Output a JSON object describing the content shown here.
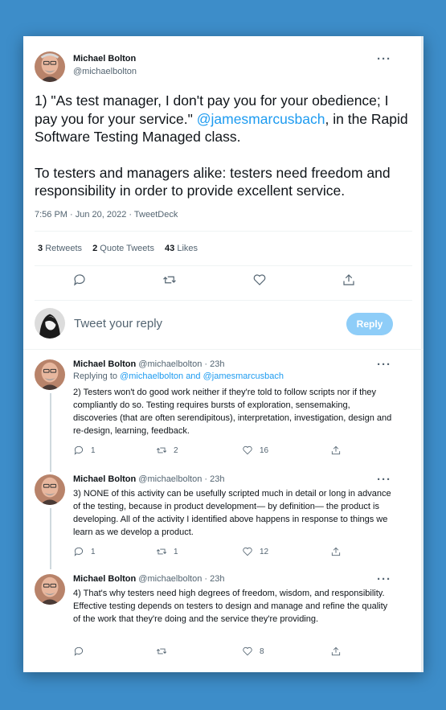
{
  "tweet": {
    "author_name": "Michael Bolton",
    "author_handle": "@michaelbolton",
    "text_line1_a": "1) \"As test manager, I don't pay you for your obedience; I pay you for your service.\"",
    "mention": "@jamesmarcusbach",
    "text_line1_b": ", in the Rapid Software Testing Managed class.",
    "text_para2": "To testers and managers alike: testers need freedom and responsibility in order to provide excellent service.",
    "meta": "7:56 PM · Jun 20, 2022 · TweetDeck",
    "retweets_count": "3",
    "retweets_label": "Retweets",
    "quotes_count": "2",
    "quotes_label": "Quote Tweets",
    "likes_count": "43",
    "likes_label": "Likes"
  },
  "composer": {
    "placeholder": "Tweet your reply",
    "reply_label": "Reply"
  },
  "replies": [
    {
      "name": "Michael Bolton",
      "handle_time": "@michaelbolton · 23h",
      "replying_prefix": "Replying to ",
      "replying_to": "@michaelbolton and @jamesmarcusbach",
      "text": "2) Testers won't do good work neither if they're told to follow scripts nor if they compliantly do so. Testing requires bursts of exploration, sensemaking, discoveries (that are often serendipitous), interpretation, investigation, design and re-design, learning, feedback.",
      "replies": "1",
      "retweets": "2",
      "likes": "16"
    },
    {
      "name": "Michael Bolton",
      "handle_time": "@michaelbolton · 23h",
      "text": "3) NONE of this activity can be usefully scripted much in detail or long in advance of the testing, because in product development— by definition— the product is developing. All of the activity I identified above happens in response to things we learn as we develop a product.",
      "replies": "1",
      "retweets": "1",
      "likes": "12"
    },
    {
      "name": "Michael Bolton",
      "handle_time": "@michaelbolton · 23h",
      "text": "4) That's why testers need high degrees of freedom, wisdom, and responsibility. Effective testing depends on testers to design and manage and refine the quality of the work that they're doing and the service they're providing.",
      "replies": "",
      "retweets": "",
      "likes": "8"
    }
  ],
  "icons": {
    "more": "more-icon",
    "reply": "reply-icon",
    "retweet": "retweet-icon",
    "like": "heart-icon",
    "share": "share-icon"
  },
  "colors": {
    "background": "#3d8dc9",
    "accent": "#1d9bf0",
    "reply_button": "#8ecdf8"
  }
}
